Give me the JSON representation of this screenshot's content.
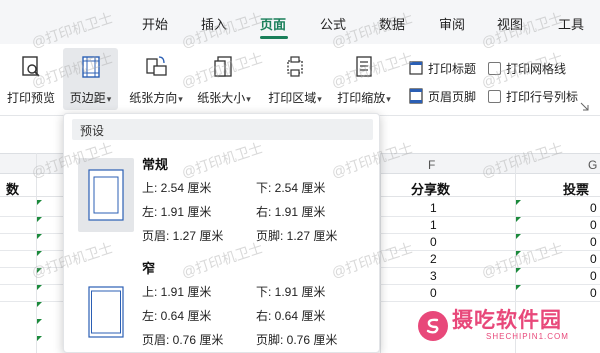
{
  "menu": {
    "tabs": [
      "开始",
      "插入",
      "页面",
      "公式",
      "数据",
      "审阅",
      "视图",
      "工具"
    ],
    "active_index": 2
  },
  "ribbon": {
    "print_preview": "打印预览",
    "margins": "页边距",
    "orientation": "纸张方向",
    "size": "纸张大小",
    "print_area": "打印区域",
    "print_scale": "打印缩放",
    "print_titles": "打印标题",
    "header_footer": "页眉页脚",
    "print_gridlines": "打印网格线",
    "print_row_col_headers": "打印行号列标"
  },
  "sheet": {
    "col_letter_f": "F",
    "col_letter_g": "G",
    "header_left": "数",
    "header_f": "分享数",
    "header_g": "投票",
    "f_values": [
      "1",
      "1",
      "0",
      "2",
      "3",
      "0"
    ],
    "g_values": [
      "0",
      "0",
      "0",
      "0",
      "0",
      "0"
    ]
  },
  "dropdown": {
    "section_title": "预设",
    "presets": [
      {
        "name": "常规",
        "top": "上: 2.54 厘米",
        "bottom": "下: 2.54 厘米",
        "left": "左: 1.91 厘米",
        "right": "右: 1.91 厘米",
        "header": "页眉: 1.27 厘米",
        "footer": "页脚: 1.27 厘米"
      },
      {
        "name": "窄",
        "top": "上: 1.91 厘米",
        "bottom": "下: 1.91 厘米",
        "left": "左: 0.64 厘米",
        "right": "右: 0.64 厘米",
        "header": "页眉: 0.76 厘米",
        "footer": "页脚: 0.76 厘米"
      }
    ]
  },
  "watermark": "@打印机卫士",
  "logo": {
    "main": "摄吃软件园",
    "sub": "SHECHIPIN1.COM"
  },
  "colors": {
    "accent": "#1a7f5a",
    "logo": "#e8487a"
  }
}
